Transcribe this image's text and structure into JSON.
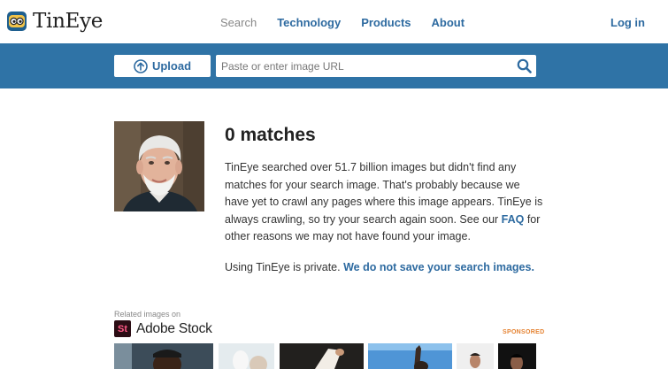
{
  "header": {
    "logo_text": "TinEye",
    "nav": [
      {
        "label": "Search",
        "active": true
      },
      {
        "label": "Technology",
        "active": false
      },
      {
        "label": "Products",
        "active": false
      },
      {
        "label": "About",
        "active": false
      }
    ],
    "login_label": "Log in"
  },
  "searchbar": {
    "upload_label": "Upload",
    "url_placeholder": "Paste or enter image URL"
  },
  "results": {
    "title": "0 matches",
    "desc_part1": "TinEye searched over 51.7 billion images but didn't find any matches for your search image. That's probably because we have yet to crawl any pages where this image appears. TinEye is always crawling, so try your search again soon. See our ",
    "faq_link": "FAQ",
    "desc_part2": " for other reasons we may not have found your image.",
    "private_text": "Using TinEye is private. ",
    "private_link": "We do not save your search images."
  },
  "related": {
    "label": "Related images on",
    "stock_badge": "St",
    "stock_name": "Adobe Stock",
    "sponsored": "SPONSORED"
  },
  "colors": {
    "brand_blue": "#2f73a6",
    "link_blue": "#2d6aa0",
    "sponsored_orange": "#e58231"
  }
}
